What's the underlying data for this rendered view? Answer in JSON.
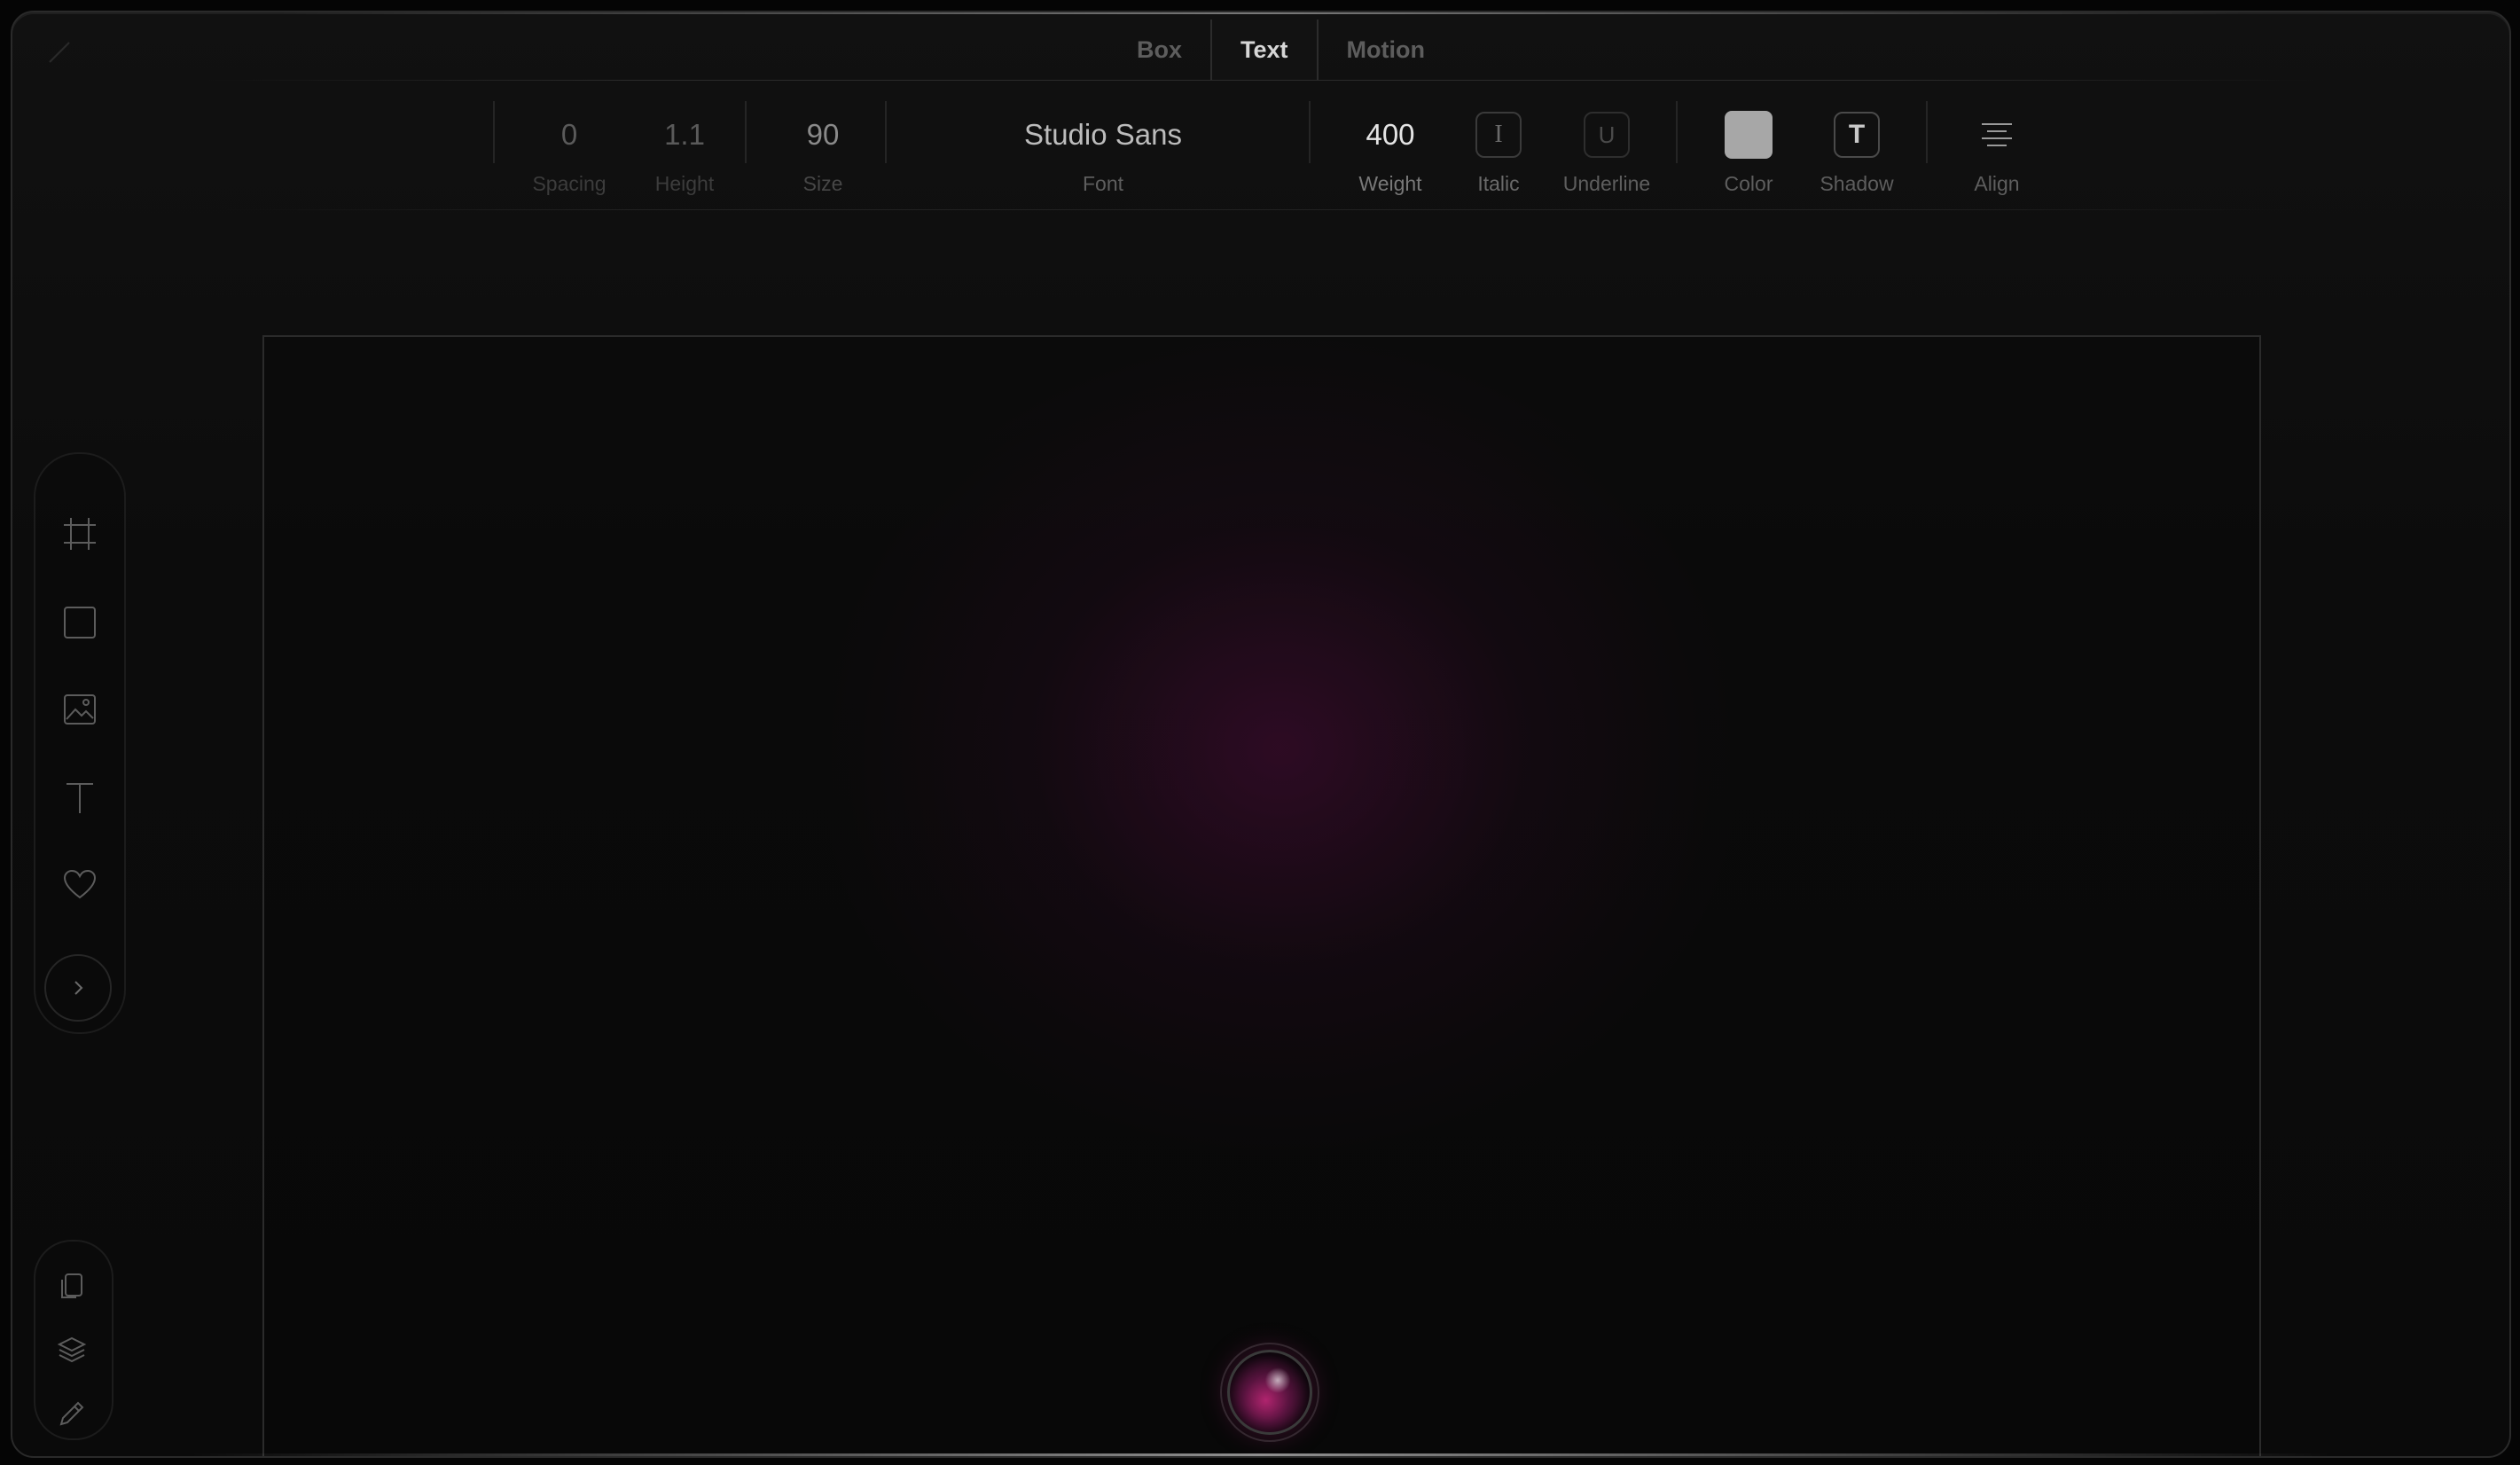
{
  "tabs": [
    {
      "label": "Box",
      "active": false
    },
    {
      "label": "Text",
      "active": true
    },
    {
      "label": "Motion",
      "active": false
    }
  ],
  "toolbar": {
    "spacing": {
      "value": "0",
      "label": "Spacing"
    },
    "height": {
      "value": "1.1",
      "label": "Height"
    },
    "size": {
      "value": "90",
      "label": "Size"
    },
    "font": {
      "value": "Studio Sans",
      "label": "Font"
    },
    "weight": {
      "value": "400",
      "label": "Weight"
    },
    "italic": {
      "label": "Italic",
      "glyph": "I"
    },
    "underline": {
      "label": "Underline",
      "glyph": "U"
    },
    "color": {
      "label": "Color",
      "swatch": "#a7a7a7"
    },
    "shadow": {
      "label": "Shadow",
      "glyph": "T"
    },
    "align": {
      "label": "Align"
    }
  },
  "left_tools": [
    "frame-icon",
    "rectangle-icon",
    "image-icon",
    "text-icon",
    "heart-icon",
    "chevron-right-icon"
  ],
  "bottom_tools": [
    "copy-icon",
    "layers-icon",
    "pencil-icon"
  ],
  "colors": {
    "background": "#0c0c0c",
    "accent_glow": "#7a125c",
    "text_active": "#d6d6d6"
  }
}
